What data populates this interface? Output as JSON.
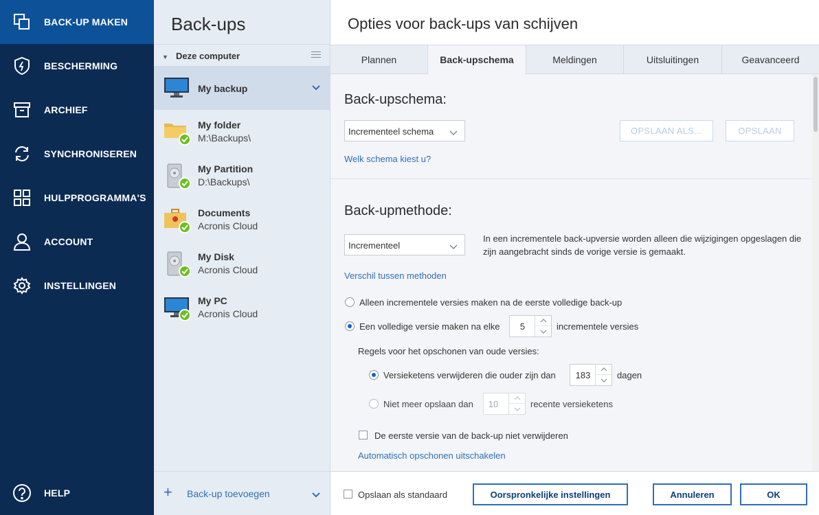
{
  "nav": {
    "items": [
      {
        "label": "BACK-UP MAKEN",
        "icon": "backup-copy-icon"
      },
      {
        "label": "BESCHERMING",
        "icon": "shield-icon"
      },
      {
        "label": "ARCHIEF",
        "icon": "archive-box-icon"
      },
      {
        "label": "SYNCHRONISEREN",
        "icon": "sync-icon"
      },
      {
        "label": "HULPPROGRAMMA'S",
        "icon": "grid-icon"
      },
      {
        "label": "ACCOUNT",
        "icon": "user-icon"
      },
      {
        "label": "INSTELLINGEN",
        "icon": "gear-icon"
      }
    ],
    "help": {
      "label": "HELP",
      "icon": "help-icon"
    }
  },
  "backups": {
    "title": "Back-ups",
    "group": "Deze computer",
    "items": [
      {
        "name": "My backup",
        "sub": "",
        "icon": "monitor-icon"
      },
      {
        "name": "My folder",
        "sub": "M:\\Backups\\",
        "icon": "folder-icon"
      },
      {
        "name": "My Partition",
        "sub": "D:\\Backups\\",
        "icon": "hard-drive-icon"
      },
      {
        "name": "Documents",
        "sub": "Acronis Cloud",
        "icon": "briefcase-icon"
      },
      {
        "name": "My Disk",
        "sub": "Acronis Cloud",
        "icon": "hard-drive-icon"
      },
      {
        "name": "My PC",
        "sub": "Acronis Cloud",
        "icon": "monitor-icon"
      }
    ],
    "add_label": "Back-up toevoegen"
  },
  "main": {
    "title": "Opties voor back-ups van schijven",
    "tabs": [
      {
        "label": "Plannen"
      },
      {
        "label": "Back-upschema"
      },
      {
        "label": "Meldingen"
      },
      {
        "label": "Uitsluitingen"
      },
      {
        "label": "Geavanceerd"
      }
    ],
    "active_tab": "Back-upschema",
    "schema": {
      "title": "Back-upschema:",
      "dropdown_value": "Incrementeel schema",
      "save_as_label": "OPSLAAN ALS...",
      "save_label": "OPSLAAN",
      "help_link": "Welk schema kiest u?"
    },
    "method": {
      "title": "Back-upmethode:",
      "dropdown_value": "Incrementeel",
      "description": "In een incrementele back-upversie worden alleen die wijzigingen opgeslagen die zijn aangebracht sinds de vorige versie is gemaakt.",
      "diff_link": "Verschil tussen methoden",
      "option_incremental_only": "Alleen incrementele versies maken na de eerste volledige back-up",
      "option_full_after_prefix": "Een volledige versie maken na elke",
      "full_after_value": "5",
      "option_full_after_suffix": "incrementele versies",
      "cleanup_rules_label": "Regels voor het opschonen van oude versies:",
      "rule_delete_older_prefix": "Versieketens verwijderen die ouder zijn dan",
      "rule_delete_older_value": "183",
      "rule_delete_older_suffix": "dagen",
      "rule_keep_max_prefix": "Niet meer opslaan dan",
      "rule_keep_max_value": "10",
      "rule_keep_max_suffix": "recente versieketens",
      "keep_first_label": "De eerste versie van de back-up niet verwijderen",
      "disable_cleanup_link": "Automatisch opschonen uitschakelen"
    },
    "footer": {
      "save_default_label": "Opslaan als standaard",
      "original_settings_label": "Oorspronkelijke instellingen",
      "cancel_label": "Annuleren",
      "ok_label": "OK"
    }
  },
  "colors": {
    "nav_bg": "#0c2b53",
    "nav_active": "#0d5199",
    "accent": "#2f6fb6",
    "check_green": "#6cbe21"
  }
}
